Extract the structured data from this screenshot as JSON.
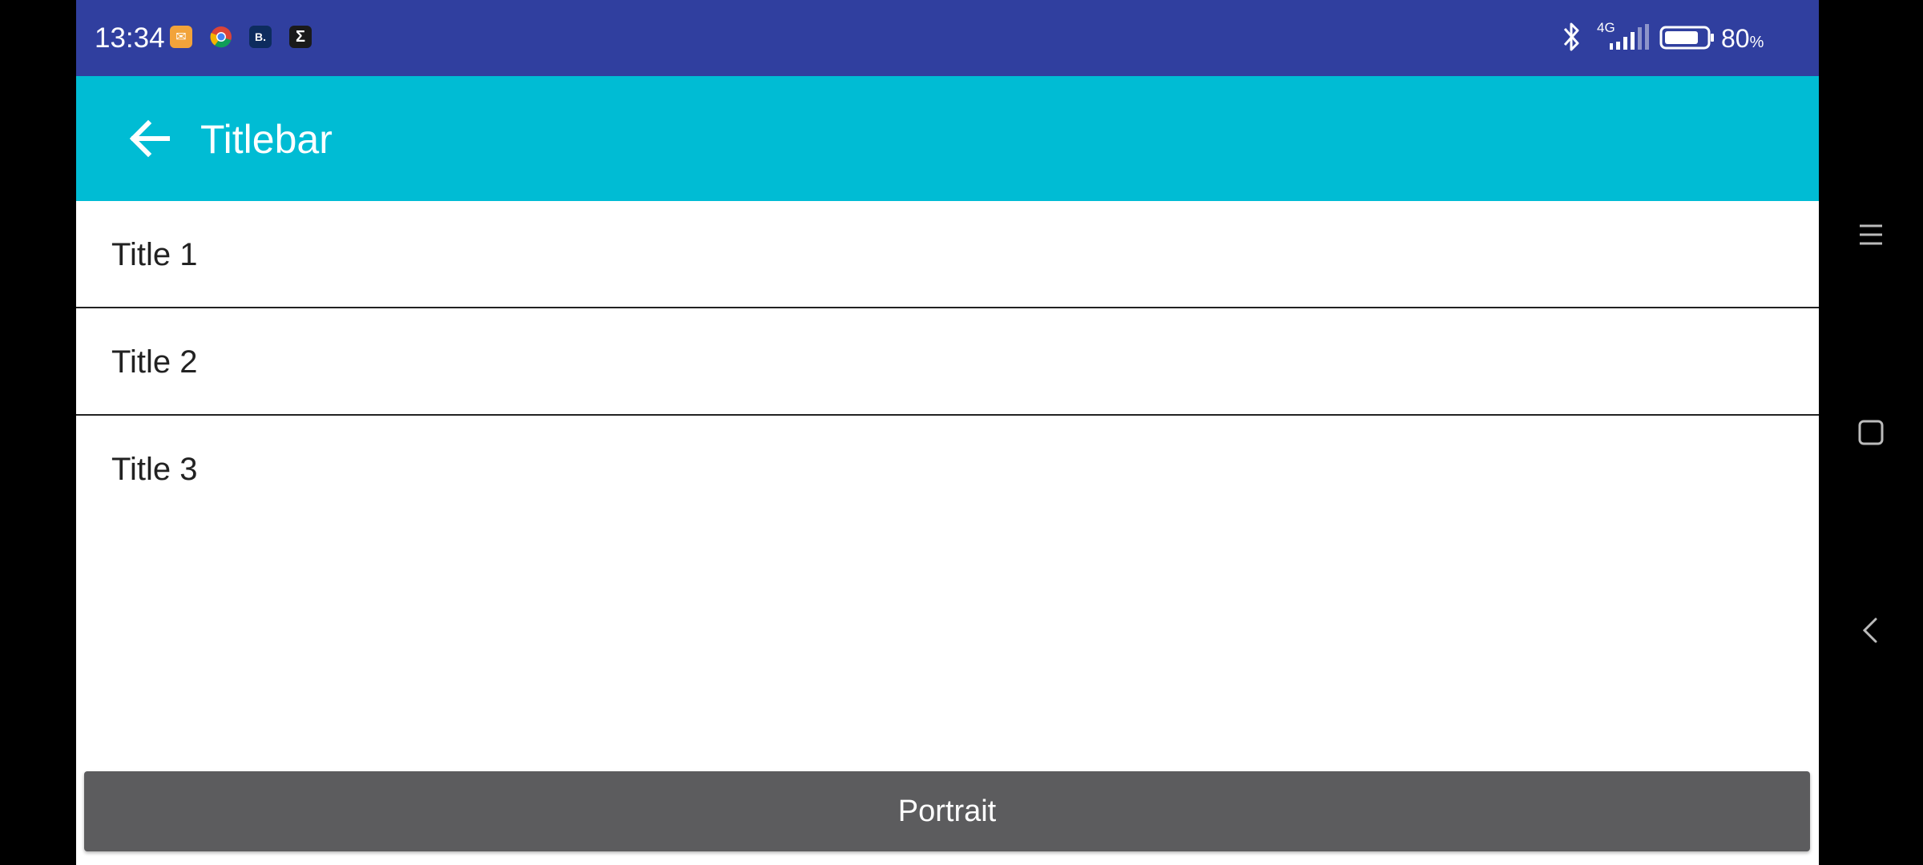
{
  "status_bar": {
    "time": "13:34",
    "notifications": [
      {
        "icon": "app-orange-icon",
        "glyph": "✉"
      },
      {
        "icon": "chrome-icon",
        "glyph": ""
      },
      {
        "icon": "b-app-icon",
        "glyph": "B."
      },
      {
        "icon": "sigma-app-icon",
        "glyph": "Σ"
      }
    ],
    "network": "4G",
    "battery_level": "80",
    "battery_unit": "%"
  },
  "app_bar": {
    "title": "Titlebar",
    "back_icon": "arrow-back-icon"
  },
  "list": {
    "items": [
      {
        "label": "Title 1"
      },
      {
        "label": "Title 2"
      },
      {
        "label": "Title 3"
      }
    ]
  },
  "footer": {
    "button_label": "Portrait"
  },
  "nav_bar": {
    "icons": [
      "menu-icon",
      "home-icon",
      "back-icon"
    ]
  },
  "colors": {
    "status_bar": "#303F9F",
    "app_bar": "#00BCD4",
    "button": "#5C5C5E"
  }
}
